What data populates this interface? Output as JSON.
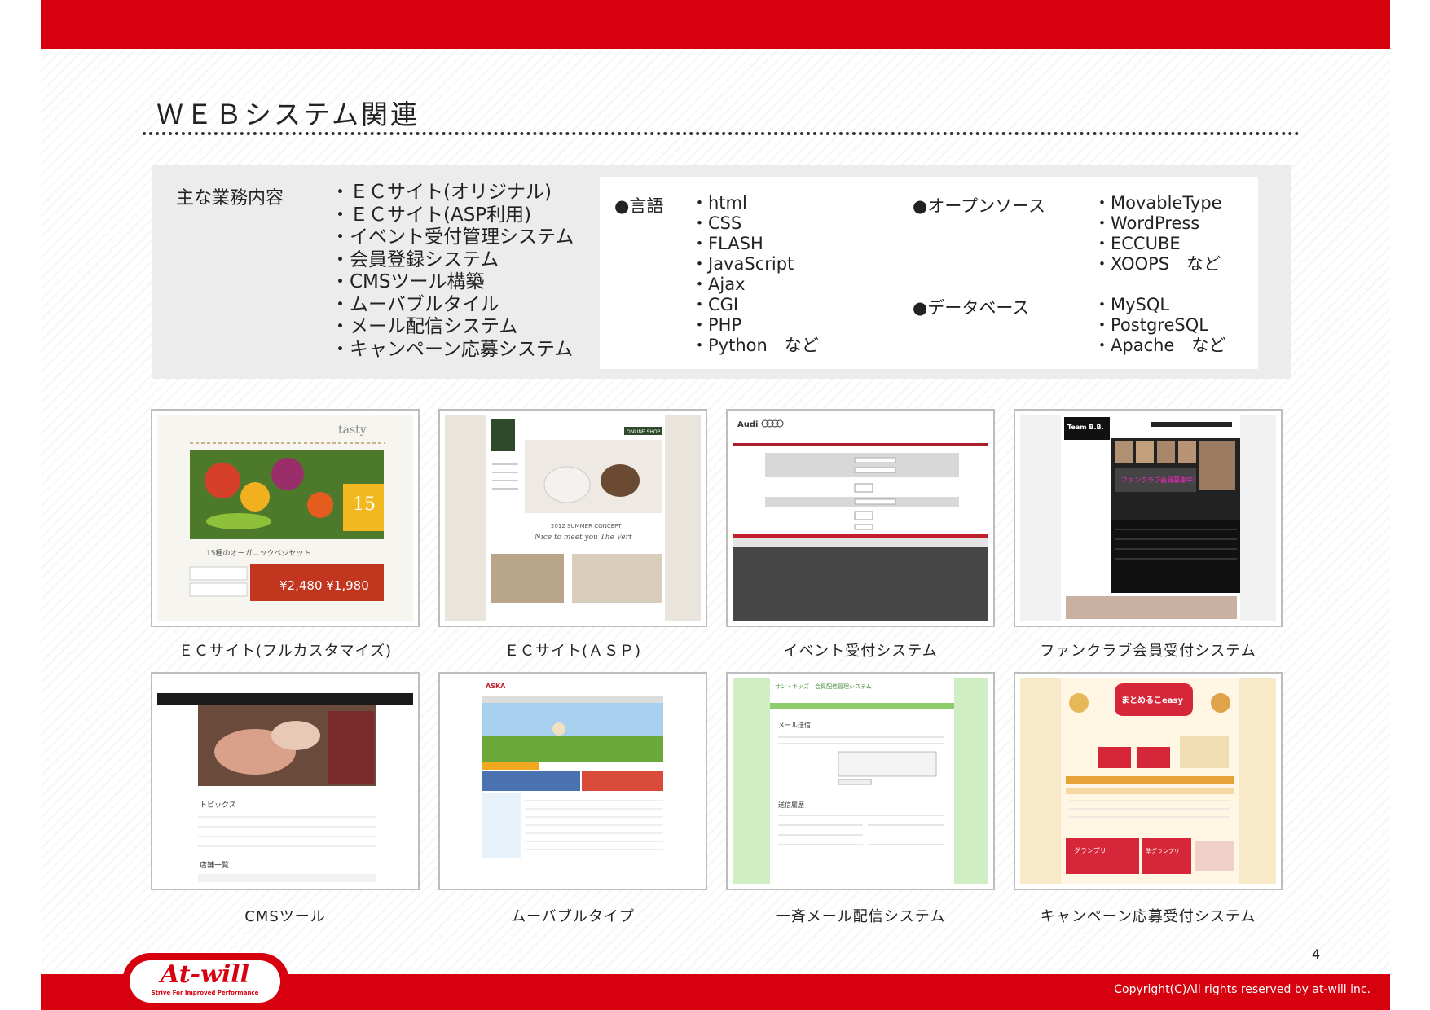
{
  "title": "ＷＥＢシステム関連",
  "services": {
    "label": "主な業務内容",
    "items": [
      "・ＥＣサイト(オリジナル)",
      "・ＥＣサイト(ASP利用)",
      "・イベント受付管理システム",
      "・会員登録システム",
      "・CMSツール構築",
      "・ムーバブルタイル",
      "・メール配信システム",
      "・キャンペーン応募システム"
    ]
  },
  "tech": {
    "languages": {
      "heading": "●言語",
      "items": [
        "・html",
        "・CSS",
        "・FLASH",
        "・JavaScript",
        "・Ajax",
        "・CGI",
        "・PHP",
        "・Python　など"
      ]
    },
    "opensource": {
      "heading": "●オープンソース",
      "items": [
        "・MovableType",
        "・WordPress",
        "・ECCUBE",
        "・XOOPS　など"
      ]
    },
    "database": {
      "heading": "●データベース",
      "items": [
        "・MySQL",
        "・PostgreSQL",
        "・Apache　など"
      ]
    }
  },
  "screenshots": [
    {
      "caption": "ＥＣサイト(フルカスタマイズ)",
      "logo": "tasty",
      "banner": "15種のオーガニックベジセット",
      "price": "¥2,480 ¥1,980",
      "badge": "15"
    },
    {
      "caption": "ＥＣサイト(ＡＳＰ)",
      "heading": "2012 SUMMER CONCEPT",
      "script": "Nice to meet you The Vert",
      "tab": "ONLINE SHOP"
    },
    {
      "caption": "イベント受付システム",
      "brand": "Audi"
    },
    {
      "caption": "ファンクラブ会員受付システム",
      "logo": "Team B.B.",
      "promo": "ファンクラブ会員募集中！"
    },
    {
      "caption": "CMSツール",
      "topics": "トピックス",
      "list": "店舗一覧"
    },
    {
      "caption": "ムーバブルタイプ",
      "logo": "ASKA"
    },
    {
      "caption": "一斉メール配信システム",
      "header": "サン・キッズ　会員配信管理システム",
      "section1": "メール送信",
      "section2": "送信履歴"
    },
    {
      "caption": "キャンペーン応募受付システム",
      "title": "まとめるこeasy",
      "prize1": "グランプリ",
      "prize2": "準グランプリ"
    }
  ],
  "footer": {
    "page_number": "4",
    "copyright": "Copyright(C)All rights reserved by at-will inc.",
    "logo_text": "At-will",
    "logo_tagline": "Strive For Improved Performance"
  },
  "colors": {
    "brand_red": "#d7000f"
  }
}
